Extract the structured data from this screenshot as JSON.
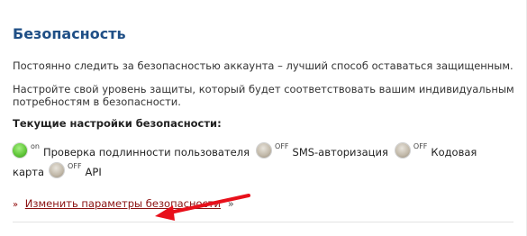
{
  "section": {
    "title": "Безопасность",
    "paragraph1": "Постоянно следить за безопасностью аккаунта – лучший способ оставаться защищенным.",
    "paragraph2": "Настройте свой уровень защиты, который будет соответствовать вашим индивидуальным потребностям в безопасности.",
    "subheading": "Текущие настройки безопасности:"
  },
  "settings": [
    {
      "tag": "on",
      "label": "Проверка подлинности пользователя",
      "state": "on"
    },
    {
      "tag": "OFF",
      "label": "SMS-авторизация",
      "state": "off"
    },
    {
      "tag": "OFF",
      "label": "Кодовая",
      "state": "off"
    },
    {
      "tag": "OFF",
      "label": "API",
      "state": "off"
    }
  ],
  "settings_wrap_word": "карта",
  "link": {
    "bullet": "»",
    "text": "Изменить параметры безопасности",
    "suffix": "»"
  },
  "colors": {
    "title": "#1f4f86",
    "link": "#8a1010",
    "arrow": "#e8101b",
    "on_indicator": "#63c83b",
    "off_indicator": "#c0b7a7"
  }
}
